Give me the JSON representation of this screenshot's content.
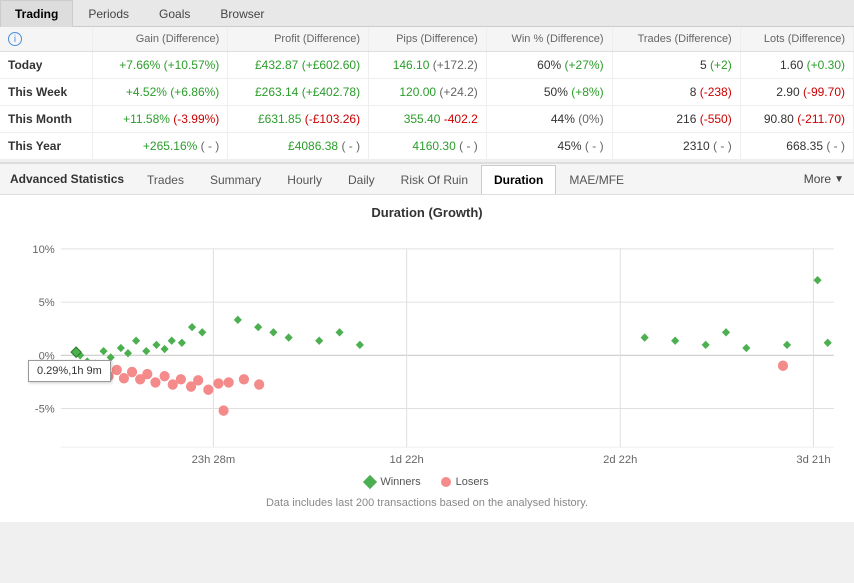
{
  "topTabs": [
    {
      "label": "Trading",
      "active": true
    },
    {
      "label": "Periods",
      "active": false
    },
    {
      "label": "Goals",
      "active": false
    },
    {
      "label": "Browser",
      "active": false
    }
  ],
  "table": {
    "headers": [
      "",
      "Gain (Difference)",
      "Profit (Difference)",
      "Pips (Difference)",
      "Win % (Difference)",
      "Trades (Difference)",
      "Lots (Difference)"
    ],
    "rows": [
      {
        "label": "Today",
        "gain": "+7.66%",
        "gainDiff": "(+10.57%)",
        "profit": "£432.87",
        "profitDiff": "(+£602.60)",
        "pips": "146.10",
        "pipsDiff": "(+172.2)",
        "win": "60%",
        "winDiff": "(+27%)",
        "trades": "5",
        "tradesDiff": "(+2)",
        "lots": "1.60",
        "lotsDiff": "(+0.30)"
      },
      {
        "label": "This Week",
        "gain": "+4.52%",
        "gainDiff": "(+6.86%)",
        "profit": "£263.14",
        "profitDiff": "(+£402.78)",
        "pips": "120.00",
        "pipsDiff": "(+24.2)",
        "win": "50%",
        "winDiff": "(+8%)",
        "trades": "8",
        "tradesDiff": "(-238)",
        "lots": "2.90",
        "lotsDiff": "(-99.70)"
      },
      {
        "label": "This Month",
        "gain": "+11.58%",
        "gainDiff": "(-3.99%)",
        "profit": "£631.85",
        "profitDiff": "(-£103.26)",
        "pips": "355.40",
        "pipsDiff": "-402.2",
        "win": "44%",
        "winDiff": "(0%)",
        "trades": "216",
        "tradesDiff": "(-550)",
        "lots": "90.80",
        "lotsDiff": "(-211.70)"
      },
      {
        "label": "This Year",
        "gain": "+265.16%",
        "gainDiff": "( - )",
        "profit": "£4086.38",
        "profitDiff": "( - )",
        "pips": "4160.30",
        "pipsDiff": "( - )",
        "win": "45%",
        "winDiff": "( - )",
        "trades": "2310",
        "tradesDiff": "( - )",
        "lots": "668.35",
        "lotsDiff": "( - )"
      }
    ]
  },
  "advStats": {
    "title": "Advanced Statistics",
    "tabs": [
      {
        "label": "Trades",
        "active": false
      },
      {
        "label": "Summary",
        "active": false
      },
      {
        "label": "Hourly",
        "active": false
      },
      {
        "label": "Daily",
        "active": false
      },
      {
        "label": "Risk Of Ruin",
        "active": false
      },
      {
        "label": "Duration",
        "active": true
      },
      {
        "label": "MAE/MFE",
        "active": false
      }
    ],
    "moreLabel": "More",
    "chartTitle": "Duration (Growth)",
    "xLabels": [
      "23h 28m",
      "1d 22h",
      "2d 22h",
      "3d 21h"
    ],
    "yLabels": [
      "10%",
      "5%",
      "0%",
      "-5%"
    ],
    "tooltip": "0.29%,1h 9m",
    "legend": {
      "winnersLabel": "Winners",
      "losersLabel": "Losers"
    },
    "footer": "Data includes last 200 transactions based on the analysed history."
  }
}
